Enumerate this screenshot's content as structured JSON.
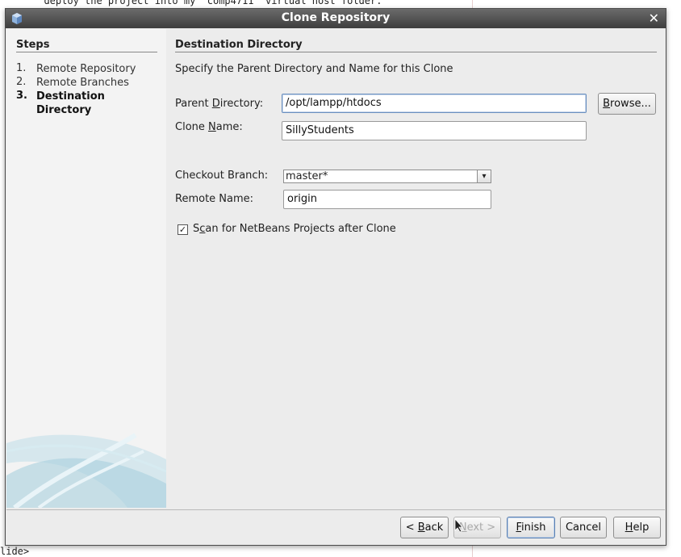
{
  "background": {
    "top_line": "  deploy the project into my \"comp4711\" virtual host folder.",
    "bottom_line": "lide>"
  },
  "dialog": {
    "title": "Clone Repository",
    "close_glyph": "✕"
  },
  "steps": {
    "heading": "Steps",
    "items": [
      {
        "num": "1.",
        "label": "Remote Repository"
      },
      {
        "num": "2.",
        "label": "Remote Branches"
      },
      {
        "num": "3.",
        "label": "Destination Directory"
      }
    ]
  },
  "content": {
    "title": "Destination Directory",
    "description": "Specify the Parent Directory and Name for this Clone",
    "parent_dir_label_pre": "Parent ",
    "parent_dir_label_mnemonic": "D",
    "parent_dir_label_post": "irectory:",
    "parent_dir_value": "/opt/lampp/htdocs",
    "browse_label_mnemonic": "B",
    "browse_label_post": "rowse...",
    "clone_name_label_pre": "Clone ",
    "clone_name_label_mnemonic": "N",
    "clone_name_label_post": "ame:",
    "clone_name_value": "SillyStudents",
    "checkout_branch_label": "Checkout Branch:",
    "checkout_branch_value": "master*",
    "remote_name_label": "Remote Name:",
    "remote_name_value": "origin",
    "scan_checked": true,
    "scan_label_pre": "S",
    "scan_label_mnemonic": "c",
    "scan_label_post": "an for NetBeans Projects after Clone"
  },
  "buttons": {
    "back_pre": "< ",
    "back_mnemonic": "B",
    "back_post": "ack",
    "next_mnemonic": "N",
    "next_post": "ext >",
    "finish_mnemonic": "F",
    "finish_post": "inish",
    "cancel": "Cancel",
    "help_mnemonic": "H",
    "help_post": "elp"
  }
}
